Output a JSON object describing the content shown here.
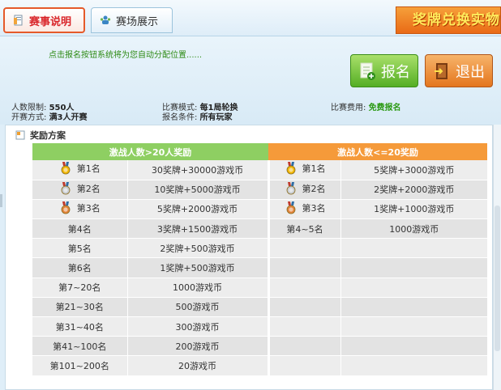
{
  "tabs": [
    {
      "label": "赛事说明",
      "active": true,
      "icon": "rules-doc-icon"
    },
    {
      "label": "赛场展示",
      "active": false,
      "icon": "venue-people-icon"
    }
  ],
  "banner": {
    "text": "奖牌兑换实物"
  },
  "notice": "点击报名按钮系统将为您自动分配位置......",
  "buttons": {
    "signup": "报名",
    "exit": "退出"
  },
  "info": {
    "player_limit_label": "人数限制:",
    "player_limit_value": "550人",
    "start_mode_label": "开赛方式:",
    "start_mode_value": "满3人开赛",
    "match_mode_label": "比赛模式:",
    "match_mode_value": "每1局轮换",
    "signup_cond_label": "报名条件:",
    "signup_cond_value": "所有玩家",
    "fee_label": "比赛费用:",
    "fee_value": "免费报名"
  },
  "reward": {
    "section_title": "奖励方案",
    "left_header": "激战人数>20人奖励",
    "right_header": "激战人数<=20奖励",
    "rows": [
      {
        "rank": "第1名",
        "prize": "30奖牌+30000游戏币",
        "medal": "gold",
        "rank_r": "第1名",
        "prize_r": "5奖牌+3000游戏币",
        "medal_r": "gold"
      },
      {
        "rank": "第2名",
        "prize": "10奖牌+5000游戏币",
        "medal": "silver",
        "rank_r": "第2名",
        "prize_r": "2奖牌+2000游戏币",
        "medal_r": "silver"
      },
      {
        "rank": "第3名",
        "prize": "5奖牌+2000游戏币",
        "medal": "bronze",
        "rank_r": "第3名",
        "prize_r": "1奖牌+1000游戏币",
        "medal_r": "bronze"
      },
      {
        "rank": "第4名",
        "prize": "3奖牌+1500游戏币",
        "medal": "",
        "rank_r": "第4~5名",
        "prize_r": "1000游戏币",
        "medal_r": ""
      },
      {
        "rank": "第5名",
        "prize": "2奖牌+500游戏币",
        "medal": "",
        "rank_r": "",
        "prize_r": "",
        "medal_r": ""
      },
      {
        "rank": "第6名",
        "prize": "1奖牌+500游戏币",
        "medal": "",
        "rank_r": "",
        "prize_r": "",
        "medal_r": ""
      },
      {
        "rank": "第7~20名",
        "prize": "1000游戏币",
        "medal": "",
        "rank_r": "",
        "prize_r": "",
        "medal_r": ""
      },
      {
        "rank": "第21~30名",
        "prize": "500游戏币",
        "medal": "",
        "rank_r": "",
        "prize_r": "",
        "medal_r": ""
      },
      {
        "rank": "第31~40名",
        "prize": "300游戏币",
        "medal": "",
        "rank_r": "",
        "prize_r": "",
        "medal_r": ""
      },
      {
        "rank": "第41~100名",
        "prize": "200游戏币",
        "medal": "",
        "rank_r": "",
        "prize_r": "",
        "medal_r": ""
      },
      {
        "rank": "第101~200名",
        "prize": "20游戏币",
        "medal": "",
        "rank_r": "",
        "prize_r": "",
        "medal_r": ""
      }
    ]
  },
  "colors": {
    "gold": "#f2b705",
    "silver": "#c8ccd2",
    "bronze": "#e2833a",
    "header_left": "#8ecf62",
    "header_right": "#f59a3a"
  }
}
